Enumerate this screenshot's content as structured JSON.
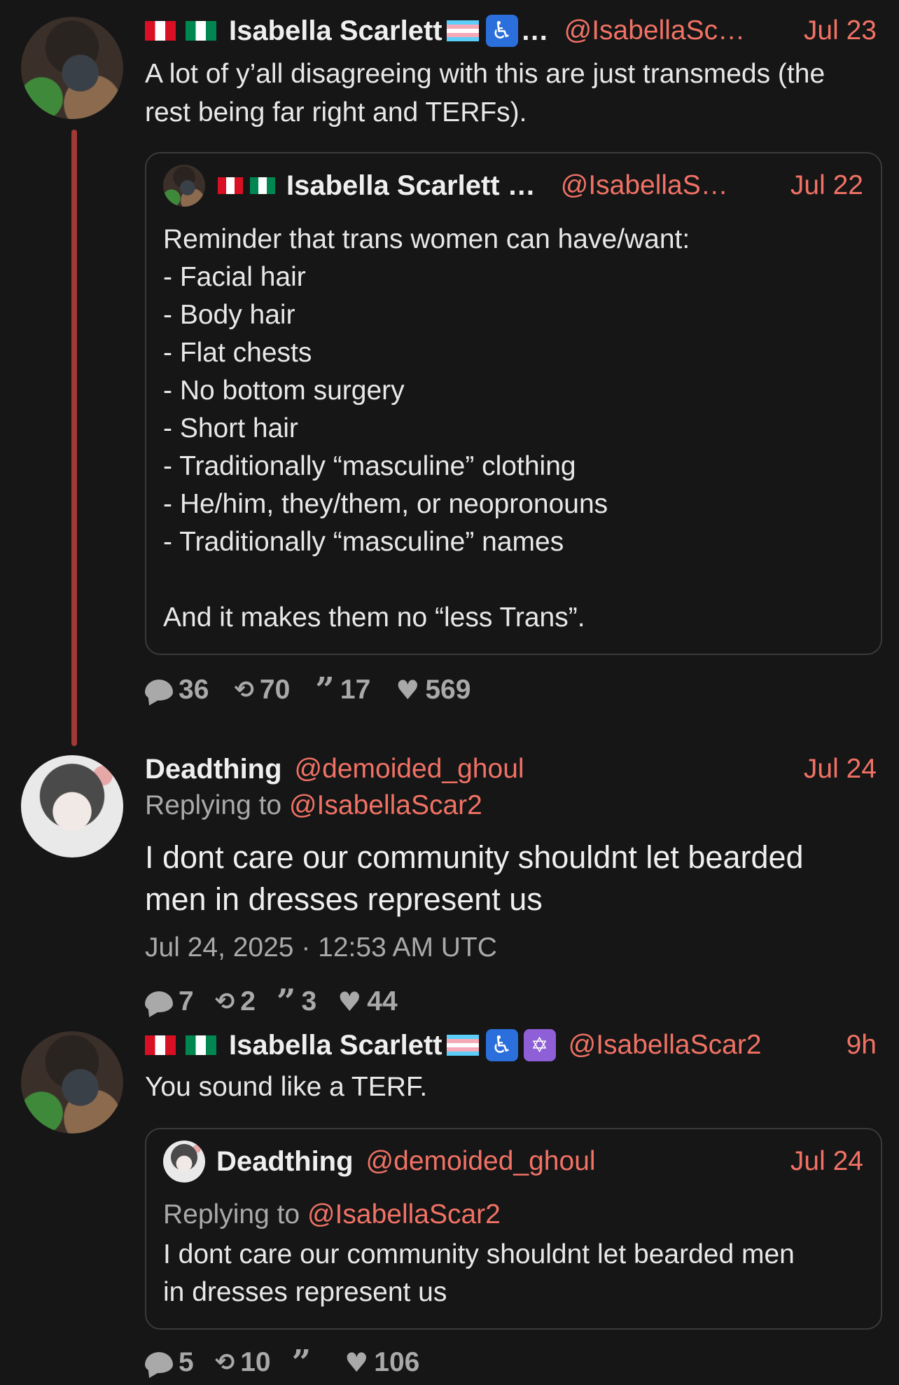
{
  "posts": [
    {
      "name": "Isabella Scarlett",
      "handle": "@IsabellaSc…",
      "time": "Jul 23",
      "text_line1": "A lot of y’all disagreeing with this are just transmeds (the",
      "text_line2": "rest being far right and TERFs).",
      "quote": {
        "name": "Isabella Scarlett …",
        "handle": "@IsabellaS…",
        "time": "Jul 22",
        "lines": [
          "Reminder that trans women can have/want:",
          "- Facial hair",
          "- Body hair",
          "- Flat chests",
          "- No bottom surgery",
          "- Short hair",
          "- Traditionally “masculine” clothing",
          "- He/him, they/them, or neopronouns",
          "- Traditionally “masculine” names",
          "",
          "And it makes them no “less Trans”."
        ]
      },
      "stats": {
        "replies": "36",
        "retweets": "70",
        "quotes": "17",
        "likes": "569"
      }
    },
    {
      "name": "Deadthing",
      "handle": "@demoided_ghoul",
      "time": "Jul 24",
      "replying_prefix": "Replying to ",
      "replying_handle": "@IsabellaScar2",
      "text_line1": "I dont care our community shouldnt let bearded",
      "text_line2": "men in dresses represent us",
      "timestamp": "Jul 24, 2025 · 12:53 AM UTC",
      "stats": {
        "replies": "7",
        "retweets": "2",
        "quotes": "3",
        "likes": "44"
      }
    },
    {
      "name": "Isabella Scarlett",
      "handle": "@IsabellaScar2",
      "time": "9h",
      "text": "You sound like a TERF.",
      "quote": {
        "name": "Deadthing",
        "handle": "@demoided_ghoul",
        "time": "Jul 24",
        "replying_prefix": "Replying to ",
        "replying_handle": "@IsabellaScar2",
        "line1": "I dont care our community shouldnt let bearded men",
        "line2": "in dresses represent us"
      },
      "stats": {
        "replies": "5",
        "retweets": "10",
        "quotes": "",
        "likes": "106"
      }
    }
  ],
  "icons": {
    "ellipsis": "…",
    "wheelchair": "♿",
    "star_of_david": "✡",
    "retweet": "⟲",
    "quote": "”",
    "heart": "♥"
  }
}
